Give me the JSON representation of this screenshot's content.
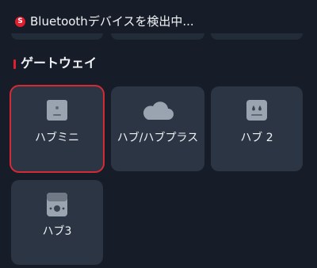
{
  "scan": {
    "icon": "s-brand-icon",
    "text": "Bluetoothデバイスを検出中..."
  },
  "section": {
    "title": "ゲートウェイ"
  },
  "devices": [
    {
      "label": "ハブミニ",
      "icon": "hub-mini-icon",
      "selected": true
    },
    {
      "label": "ハブ/ハブプラス",
      "icon": "cloud-icon",
      "selected": false
    },
    {
      "label": "ハブ 2",
      "icon": "hub2-icon",
      "selected": false
    },
    {
      "label": "ハブ3",
      "icon": "hub3-icon",
      "selected": false
    }
  ],
  "colors": {
    "background": "#161d28",
    "card": "#2b3544",
    "accent": "#e11d2e",
    "selection": "#d42a34"
  }
}
